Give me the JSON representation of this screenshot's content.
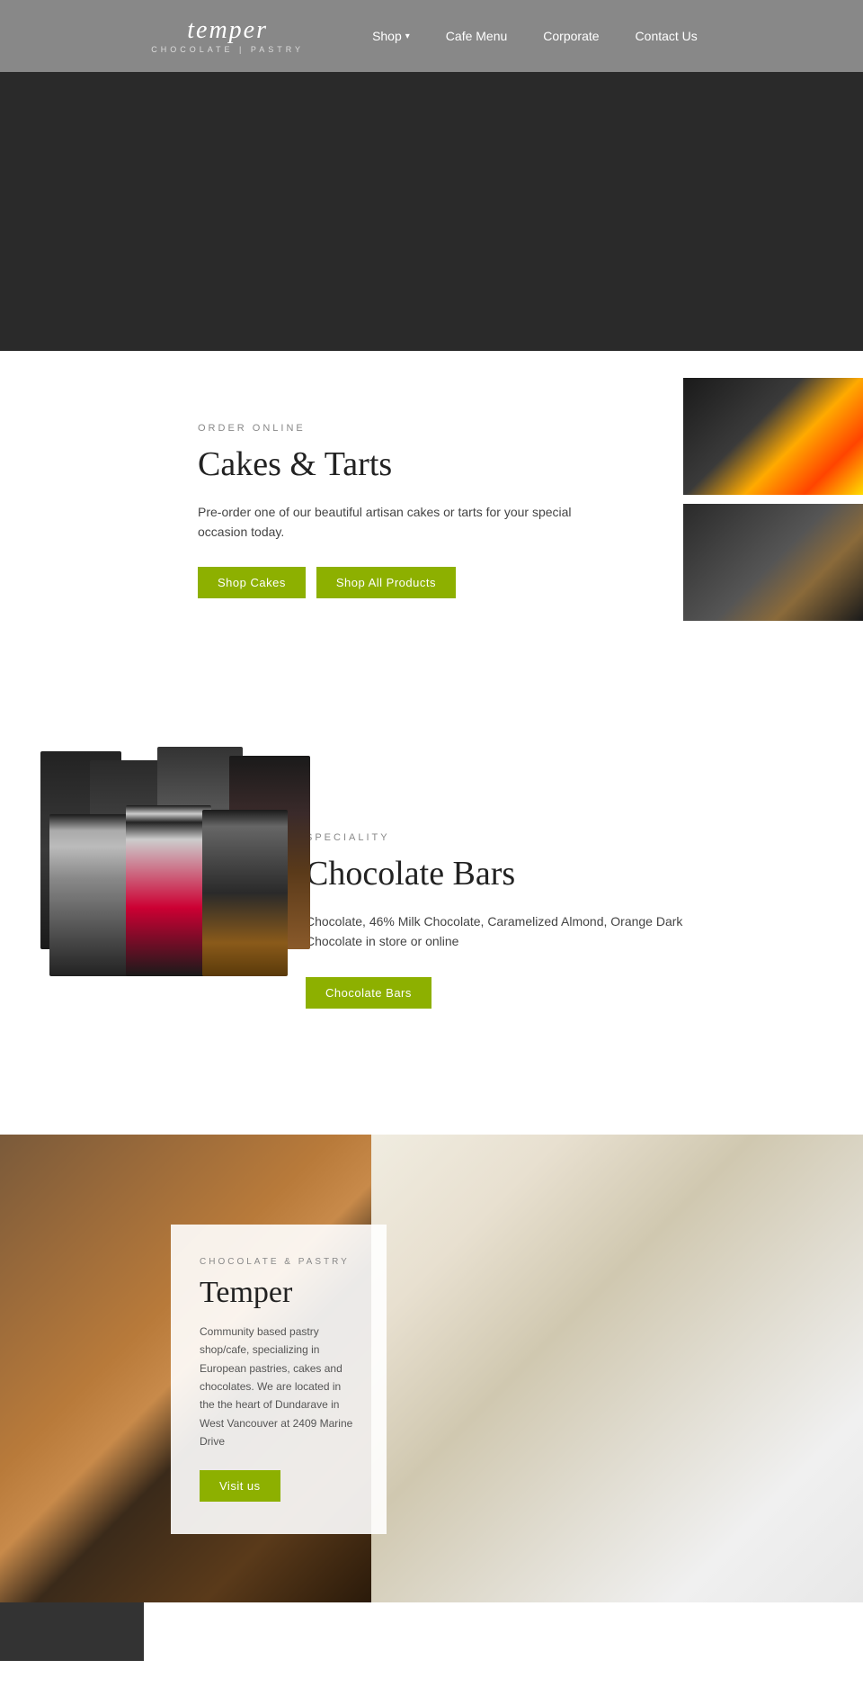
{
  "header": {
    "logo_main": "temper",
    "logo_sub": "CHOCOLATE | PASTRY",
    "nav": [
      {
        "id": "shop",
        "label": "Shop",
        "has_chevron": true
      },
      {
        "id": "cafe-menu",
        "label": "Cafe Menu",
        "has_chevron": false
      },
      {
        "id": "corporate",
        "label": "Corporate",
        "has_chevron": false
      },
      {
        "id": "contact-us",
        "label": "Contact Us",
        "has_chevron": false
      }
    ]
  },
  "cakes_section": {
    "label": "ORDER ONLINE",
    "title": "Cakes & Tarts",
    "description": "Pre-order one of our beautiful artisan cakes or tarts for your special occasion today.",
    "btn_cakes": "Shop Cakes",
    "btn_all": "Shop All Products"
  },
  "choc_section": {
    "label": "SPECIALITY",
    "title": "Chocolate Bars",
    "description": "Chocolate, 46% Milk Chocolate, Caramelized Almond, Orange Dark Chocolate in store or online",
    "btn_label": "Chocolate Bars"
  },
  "store_section": {
    "label": "CHOCOLATE & PASTRY",
    "title": "Temper",
    "description": "Community based pastry shop/cafe, specializing in European pastries, cakes and chocolates. We are located in the the heart of Dundarave in West Vancouver at 2409 Marine Drive",
    "btn_label": "Visit us"
  }
}
